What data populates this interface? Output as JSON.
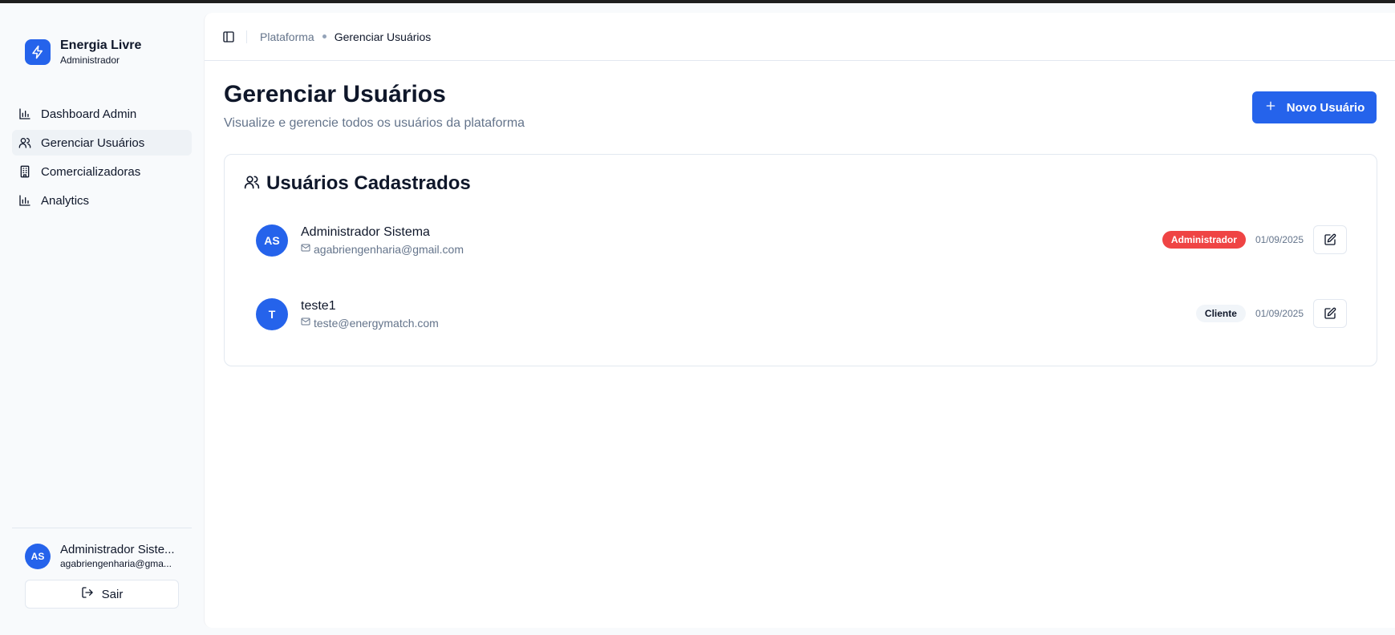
{
  "brand": {
    "name": "Energia Livre",
    "role": "Administrador",
    "icon": "lightning-icon"
  },
  "sidebar": {
    "items": [
      {
        "label": "Dashboard Admin",
        "icon": "bar-chart-icon",
        "active": false
      },
      {
        "label": "Gerenciar Usuários",
        "icon": "users-icon",
        "active": true
      },
      {
        "label": "Comercializadoras",
        "icon": "building-icon",
        "active": false
      },
      {
        "label": "Analytics",
        "icon": "bar-chart-icon",
        "active": false
      }
    ],
    "user": {
      "initials": "AS",
      "name": "Administrador Siste...",
      "email": "agabriengenharia@gma..."
    },
    "logout_label": "Sair"
  },
  "header": {
    "breadcrumb": {
      "parent": "Plataforma",
      "current": "Gerenciar Usuários"
    }
  },
  "page": {
    "title": "Gerenciar Usuários",
    "subtitle": "Visualize e gerencie todos os usuários da plataforma",
    "new_user_label": "Novo Usuário"
  },
  "card": {
    "title": "Usuários Cadastrados",
    "users": [
      {
        "initials": "AS",
        "name": "Administrador Sistema",
        "email": "agabriengenharia@gmail.com",
        "role": "Administrador",
        "date": "01/09/2025"
      },
      {
        "initials": "T",
        "name": "teste1",
        "email": "teste@energymatch.com",
        "role": "Cliente",
        "date": "01/09/2025"
      }
    ]
  },
  "colors": {
    "accent": "#2563eb",
    "admin_badge": "#ef4444",
    "client_badge": "#f1f5f9"
  }
}
